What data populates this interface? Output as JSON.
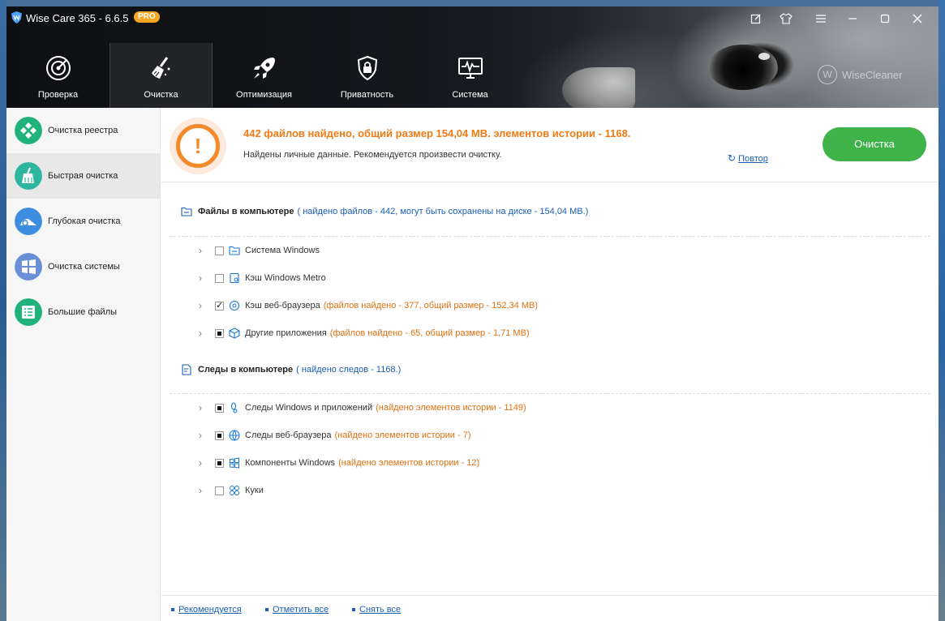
{
  "app": {
    "title": "Wise Care 365 - 6.6.5",
    "badge": "PRO",
    "brand": "WiseCleaner",
    "accent_color": "#3fb34a",
    "warning_color": "#f07a14"
  },
  "tabs": [
    {
      "label": "Проверка",
      "icon": "radar-icon"
    },
    {
      "label": "Очистка",
      "icon": "broom-icon"
    },
    {
      "label": "Оптимизация",
      "icon": "rocket-icon"
    },
    {
      "label": "Приватность",
      "icon": "lock-shield-icon"
    },
    {
      "label": "Система",
      "icon": "monitor-pulse-icon"
    }
  ],
  "sidebar": {
    "items": [
      {
        "label": "Очистка реестра",
        "icon": "registry-icon"
      },
      {
        "label": "Быстрая очистка",
        "icon": "quick-clean-icon"
      },
      {
        "label": "Глубокая очистка",
        "icon": "deep-clean-icon"
      },
      {
        "label": "Очистка системы",
        "icon": "windows-icon"
      },
      {
        "label": "Большие файлы",
        "icon": "large-files-icon"
      }
    ]
  },
  "summary": {
    "title": "442 файлов найдено, общий размер 154,04 MB. элементов истории - 1168.",
    "subtitle": "Найдены личные данные. Рекомендуется произвести очистку.",
    "retry": "Повтор",
    "clean_button": "Очистка"
  },
  "files_section": {
    "title": "Файлы в компьютере",
    "info": "( найдено файлов - 442, могут быть сохранены на диске - 154,04 MB.)",
    "rows": [
      {
        "label": "Система Windows",
        "info": "",
        "state": "unchecked"
      },
      {
        "label": "Кэш Windows Metro",
        "info": "",
        "state": "unchecked"
      },
      {
        "label": "Кэш веб-браузера",
        "info": "(файлов найдено - 377, общий размер - 152,34 MB)",
        "state": "checked"
      },
      {
        "label": "Другие приложения",
        "info": "(файлов найдено - 65, общий размер - 1,71 MB)",
        "state": "partial"
      }
    ]
  },
  "traces_section": {
    "title": "Следы в компьютере",
    "info": "( найдено следов - 1168.)",
    "rows": [
      {
        "label": "Следы Windows и приложений",
        "info": "(найдено элементов истории - 1149)",
        "state": "partial"
      },
      {
        "label": "Следы веб-браузера",
        "info": "(найдено элементов истории - 7)",
        "state": "partial"
      },
      {
        "label": "Компоненты Windows",
        "info": "(найдено элементов истории - 12)",
        "state": "partial"
      },
      {
        "label": "Куки",
        "info": "",
        "state": "unchecked"
      }
    ]
  },
  "footer": {
    "recommended": "Рекомендуется",
    "select_all": "Отметить все",
    "deselect_all": "Снять все"
  }
}
